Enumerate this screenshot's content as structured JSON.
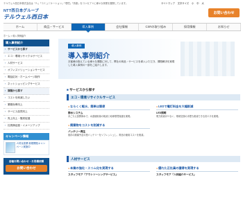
{
  "header": {
    "tagline": "テルウェル西日本株式会社は「人」「コミュニケーション」「環境」「資源」をコンセプトに様々な事業を展開しています。",
    "top_links": [
      "サイトマップ",
      "文字サイズ",
      "小",
      "中",
      "大"
    ],
    "logo_line1": "NTT西日本グループ",
    "logo_line2": "テルウェル西日本",
    "contact_button": "お問い合わせ"
  },
  "nav": {
    "items": [
      "ホーム",
      "商品・サービス",
      "導入事例",
      "会社情報",
      "CSRの取り組み",
      "採用情報",
      "お知らせ"
    ],
    "active_index": 2
  },
  "breadcrumb": "ホーム > 導入事例紹介",
  "sidebar": {
    "heading": "導入事例紹介",
    "items": [
      {
        "label": "サービスから探す",
        "group": true
      },
      {
        "label": "エコ・環境リサイクルサービス",
        "group": false
      },
      {
        "label": "人材サービス",
        "group": false
      },
      {
        "label": "オフィスソリューションサービス",
        "group": false
      },
      {
        "label": "電話応対・ホームページ制作",
        "group": false
      },
      {
        "label": "ネットショッピングサービス",
        "group": false
      },
      {
        "label": "課題から探す",
        "group": true
      },
      {
        "label": "コストを削減したい",
        "group": false
      },
      {
        "label": "業務効率向上",
        "group": false
      },
      {
        "label": "サービス品質向上",
        "group": false
      },
      {
        "label": "売上向上・販売促進",
        "group": false
      },
      {
        "label": "社員満足度・イメージアップ",
        "group": false
      }
    ],
    "campaign_heading": "キャンペーン情報",
    "campaign_text": "人材派遣業 新規開拓キャンペーン実施中",
    "inquiry_text": "各種お問い合わせ・お見積依頼",
    "inquiry_button": "お問い合わせ"
  },
  "hero": {
    "tag": "導入事例",
    "title": "導入事例紹介",
    "desc": "お客様の抱えている様々な課題に対して、弊社の商品・サービスを導入いただき、課題解決を実現した導入事例の一部をご紹介します。"
  },
  "services": {
    "heading": "サービスから探す",
    "categories": [
      {
        "title": "エコ・環境リサイクルサービス",
        "cards": [
          {
            "title": "ならくく軽水、簡単は簡便",
            "name": "節水システム",
            "desc": "手ごたえ抜群節水で、水道使用量の削減と地球環境保護を実現。"
          },
          {
            "title": "LEDで電灯料金を大幅削減",
            "name": "LED照明",
            "desc": "電力削減が少なく、電球交換の手間も削減できる省エネを実現。"
          },
          {
            "title": "廃棄物をコストを削減する",
            "name": "バッテリー再生",
            "desc": "既存の廃棄予定の鉛バッテリーをリフレッシュし、電池の使用コストを削減。"
          }
        ]
      },
      {
        "title": "人材サービス",
        "cards": [
          {
            "title": "本業の強化・スリム化を実現する",
            "name": "スタッフモア「アウトソーシングサービス」",
            "desc": ""
          },
          {
            "title": "優れた正社員の獲得を実現する",
            "name": "スタッフモア「人材紹介サービス」",
            "desc": ""
          }
        ]
      }
    ]
  },
  "colors": {
    "brand": "#1d5aa8",
    "nav_active": "#0f66b5",
    "accent": "#e8822a"
  }
}
